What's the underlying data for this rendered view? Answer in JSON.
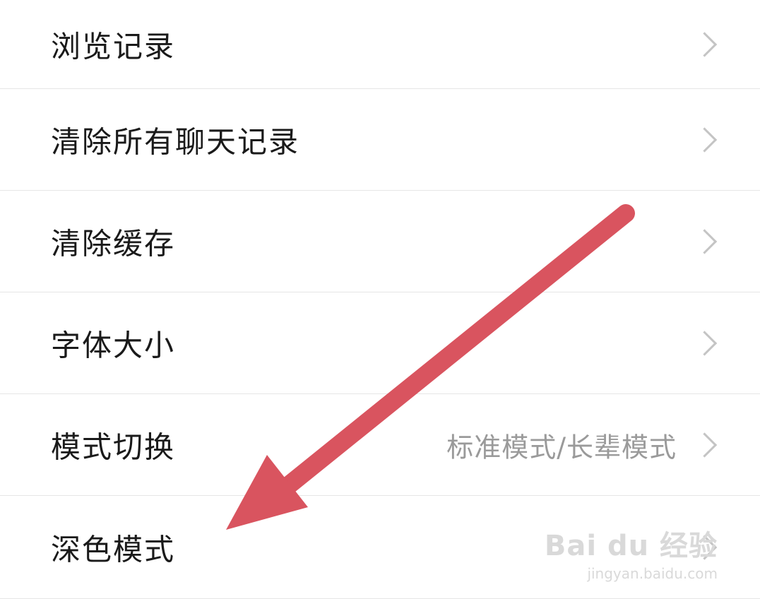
{
  "settings": {
    "items": [
      {
        "label": "浏览记录",
        "value": ""
      },
      {
        "label": "清除所有聊天记录",
        "value": ""
      },
      {
        "label": "清除缓存",
        "value": ""
      },
      {
        "label": "字体大小",
        "value": ""
      },
      {
        "label": "模式切换",
        "value": "标准模式/长辈模式"
      },
      {
        "label": "深色模式",
        "value": ""
      }
    ]
  },
  "annotation": {
    "arrow_color": "#d9545f"
  },
  "watermark": {
    "logo": "Bai du 经验",
    "url": "jingyan.baidu.com"
  }
}
